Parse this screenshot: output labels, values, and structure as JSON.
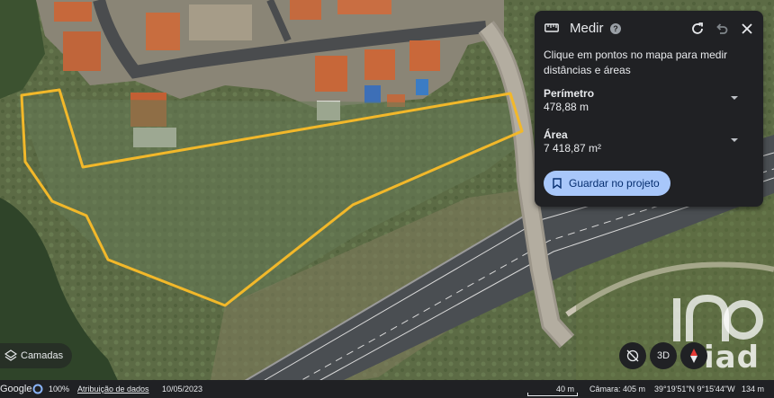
{
  "measure_panel": {
    "title": "Medir",
    "instruction": "Clique em pontos no mapa para medir distâncias e áreas",
    "perimeter_label": "Perímetro",
    "perimeter_value": "478,88 m",
    "area_label": "Área",
    "area_value": "7 418,87 m²",
    "save_label": "Guardar no projeto",
    "icons": [
      "ruler-icon",
      "help-icon",
      "reload-icon",
      "undo-icon",
      "close-icon",
      "bookmark-icon"
    ]
  },
  "layers_button": {
    "label": "Camadas",
    "icon": "layers-icon"
  },
  "controls": {
    "view_3d_label": "3D",
    "icons": [
      "tilt-icon",
      "compass-icon"
    ]
  },
  "status_bar": {
    "brand": "Google",
    "zoom": "100%",
    "attribution": "Atribuição de dados",
    "date": "10/05/2023",
    "scale": "40 m",
    "camera": "Câmara: 405 m",
    "coordinates": "39°19'51\"N 9°15'44\"W",
    "elevation": "134 m"
  },
  "watermark": {
    "text": "iad"
  },
  "colors": {
    "polygon_outline": "#f2b82a",
    "panel_bg": "#202124",
    "save_button": "#a8c7fa"
  }
}
